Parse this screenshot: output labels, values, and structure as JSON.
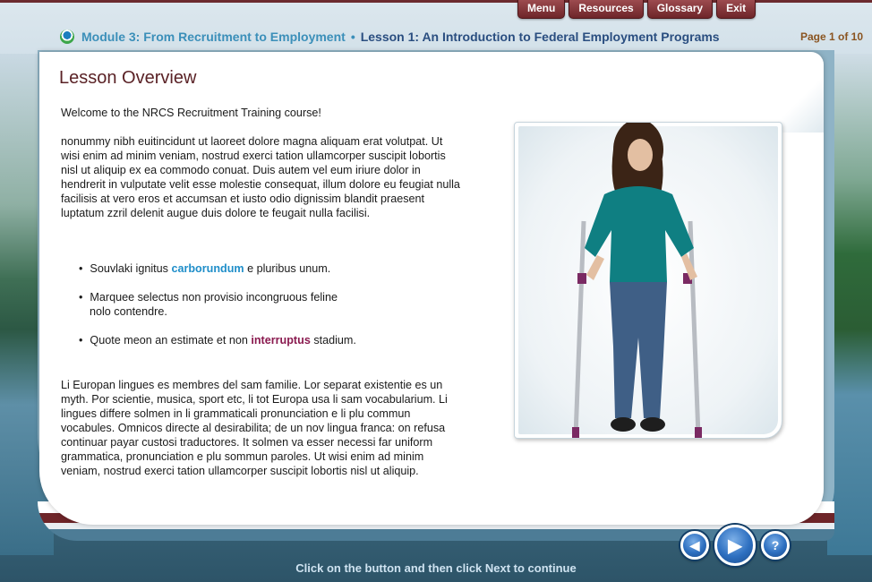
{
  "menu": [
    "Menu",
    "Resources",
    "Glossary",
    "Exit"
  ],
  "header": {
    "module": "Module 3: From Recruitment to Employment",
    "separator": "•",
    "lesson": "Lesson 1: An Introduction to Federal Employment Programs",
    "page": "Page 1 of 10"
  },
  "content": {
    "title": "Lesson Overview",
    "welcome": "Welcome to the NRCS Recruitment Training course!",
    "para1": "nonummy nibh euitincidunt ut laoreet dolore magna aliquam erat volutpat. Ut wisi enim ad minim veniam, nostrud exerci tation ullamcorper suscipit lobortis nisl ut aliquip ex ea commodo conuat. Duis autem vel eum iriure dolor in hendrerit in vulputate velit esse molestie consequat, illum dolore eu feugiat nulla facilisis at vero eros et accumsan et iusto odio dignissim blandit praesent luptatum zzril delenit augue duis dolore te feugait nulla facilisi.",
    "bullets": [
      {
        "pre": "Souvlaki ignitus ",
        "hl": "carborundum",
        "post": " e pluribus unum."
      },
      {
        "line1": "Marquee selectus non provisio incongruous feline",
        "line2": "nolo contendre."
      },
      {
        "pre": "Quote meon an estimate et non ",
        "hl": "interruptus",
        "post": " stadium."
      }
    ],
    "para2": "Li Europan lingues es membres del sam familie. Lor separat existentie es un myth. Por scientie, musica, sport etc, li tot Europa usa li sam vocabularium. Li lingues differe solmen in li grammaticali pronunciation e li plu commun vocabules. Omnicos directe al desirabilita; de un nov lingua franca: on refusa continuar payar custosi traductores. It solmen va esser necessi far uniform grammatica, pronunciation e plu sommun paroles. Ut wisi enim ad minim veniam, nostrud exerci tation ullamcorper suscipit lobortis nisl ut aliquip."
  },
  "nav": {
    "back": "◀",
    "next": "▶",
    "help": "?"
  },
  "status": "Click on the button and then click Next to continue",
  "colors": {
    "maroon": "#6e2529",
    "link_blue": "#1f8ec9",
    "highlight_purple": "#8a1a4f"
  }
}
